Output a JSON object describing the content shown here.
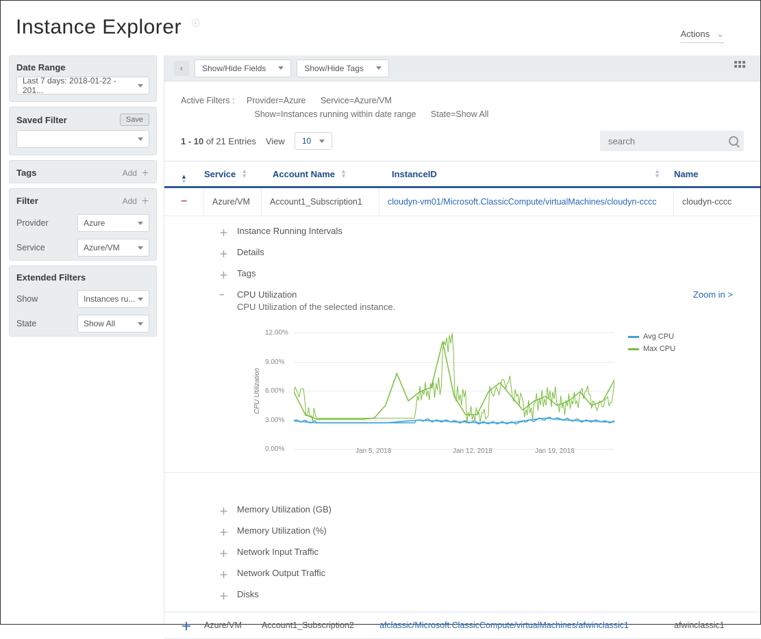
{
  "header": {
    "title": "Instance Explorer",
    "actions_label": "Actions"
  },
  "sidebar": {
    "date_range": {
      "title": "Date Range",
      "value": "Last 7 days:  2018-01-22 - 201..."
    },
    "saved_filter": {
      "title": "Saved Filter",
      "save_label": "Save"
    },
    "tags": {
      "title": "Tags",
      "add_label": "Add"
    },
    "filter": {
      "title": "Filter",
      "add_label": "Add",
      "provider_label": "Provider",
      "provider_value": "Azure",
      "service_label": "Service",
      "service_value": "Azure/VM"
    },
    "extended": {
      "title": "Extended Filters",
      "show_label": "Show",
      "show_value": "Instances ru...",
      "state_label": "State",
      "state_value": "Show All"
    }
  },
  "toolbar": {
    "fields_label": "Show/Hide Fields",
    "tags_label": "Show/Hide Tags"
  },
  "active_filters": {
    "label": "Active Filters :",
    "chips": [
      "Provider=Azure",
      "Service=Azure/VM",
      "Show=Instances running within date range",
      "State=Show All"
    ]
  },
  "entries": {
    "range": "1 - 10",
    "of_text": "of 21 Entries",
    "view_label": "View",
    "page_size": "10",
    "search_placeholder": "search"
  },
  "columns": {
    "service": "Service",
    "account": "Account Name",
    "instanceid": "InstanceID",
    "name": "Name"
  },
  "rows": [
    {
      "service": "Azure/VM",
      "account": "Account1_Subscription1",
      "instanceid": "cloudyn-vm01/Microsoft.ClassicCompute/virtualMachines/cloudyn-cccc",
      "name": "cloudyn-cccc",
      "expanded": true
    },
    {
      "service": "Azure/VM",
      "account": "Account1_Subscription2",
      "instanceid": "afclassic/Microsoft.ClassicCompute/virtualMachines/afwinclassic1",
      "name": "afwinclassic1",
      "expanded": false
    }
  ],
  "expand": {
    "intervals": "Instance Running Intervals",
    "details": "Details",
    "tags": "Tags",
    "cpu": "CPU Utilization",
    "cpu_sub": "CPU Utilization of the selected instance.",
    "zoom": "Zoom in >",
    "mem_gb": "Memory Utilization (GB)",
    "mem_pct": "Memory Utilization (%)",
    "net_in": "Network Input Traffic",
    "net_out": "Network Output Traffic",
    "disks": "Disks"
  },
  "chart_data": {
    "type": "line",
    "ylabel": "CPU Utilization",
    "ylim": [
      0,
      12
    ],
    "yticks": [
      "0.00%",
      "3.00%",
      "6.00%",
      "9.00%",
      "12.00%"
    ],
    "xticks": [
      "Jan 5, 2018",
      "Jan 12, 2018",
      "Jan 19, 2018"
    ],
    "legend": [
      {
        "name": "Avg CPU",
        "color": "#3fa3d8"
      },
      {
        "name": "Max CPU",
        "color": "#7bbd3f"
      }
    ],
    "series": [
      {
        "name": "Avg CPU",
        "color": "#3fa3d8",
        "values": [
          2.3,
          2.2,
          2.1,
          2.1,
          2.1,
          2.1,
          2.1,
          2.1,
          2.1,
          2.2,
          2.3,
          2.4,
          2.3,
          2.3,
          2.2,
          2.2,
          2.1,
          2.1,
          2.1,
          2.1,
          2.3,
          2.5,
          2.6,
          2.5,
          2.4,
          2.3,
          2.3,
          2.2,
          2.2
        ]
      },
      {
        "name": "Max CPU",
        "color": "#7bbd3f",
        "values": [
          5.5,
          3.0,
          2.5,
          2.5,
          2.5,
          2.5,
          2.5,
          2.6,
          4.0,
          7.5,
          4.5,
          5.5,
          6.0,
          11.0,
          5.0,
          3.0,
          3.0,
          5.5,
          6.5,
          5.0,
          3.5,
          4.5,
          5.0,
          4.0,
          4.5,
          5.5,
          4.0,
          4.5,
          6.8
        ]
      }
    ]
  }
}
